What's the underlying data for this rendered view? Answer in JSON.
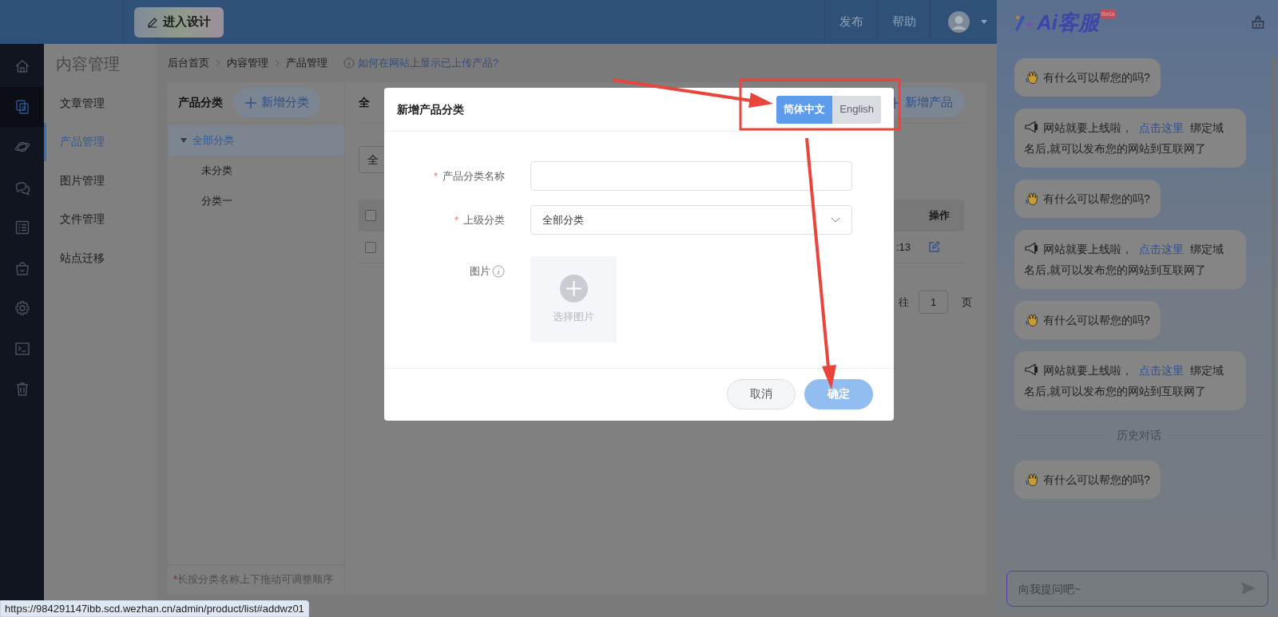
{
  "topbar": {
    "design_button": "进入设计",
    "nav": [
      "发布",
      "帮助"
    ]
  },
  "rail": [
    {
      "kind": "home",
      "selected": false
    },
    {
      "kind": "pages",
      "selected": true
    },
    {
      "kind": "planet",
      "selected": false
    },
    {
      "kind": "chat",
      "selected": false
    },
    {
      "kind": "list",
      "selected": false
    },
    {
      "kind": "bag",
      "selected": false
    },
    {
      "kind": "gear",
      "selected": false
    },
    {
      "kind": "terminal",
      "selected": false
    },
    {
      "kind": "trash",
      "selected": false
    }
  ],
  "sidebar": {
    "title": "内容管理",
    "items": [
      {
        "label": "文章管理",
        "selected": false
      },
      {
        "label": "产品管理",
        "selected": true
      },
      {
        "label": "图片管理",
        "selected": false
      },
      {
        "label": "文件管理",
        "selected": false
      },
      {
        "label": "站点迁移",
        "selected": false
      }
    ]
  },
  "breadcrumb": [
    "后台首页",
    "内容管理",
    "产品管理"
  ],
  "help_link": "如何在网站上显示已上传产品?",
  "category_panel": {
    "title": "产品分类",
    "add_button": "新增分类",
    "tree": [
      {
        "label": "全部分类",
        "selected": true,
        "expanded": true,
        "children": [
          {
            "label": "未分类",
            "selected": false
          },
          {
            "label": "分类一",
            "selected": false
          }
        ]
      }
    ],
    "footnote_mark": "*",
    "footnote": "长按分类名称上下拖动可调整顺序"
  },
  "product_panel": {
    "title": "全",
    "filter": "全",
    "add_button": "新增产品",
    "header_checked": false,
    "columns": [
      "操作"
    ],
    "rows": [
      {
        "checked": false,
        "cells": [
          ":13"
        ]
      }
    ],
    "pagination": {
      "goto": "往",
      "page": "1",
      "unit": "页"
    }
  },
  "dialog": {
    "title": "新增产品分类",
    "languages": [
      {
        "label": "简体中文",
        "selected": true
      },
      {
        "label": "English",
        "selected": false
      }
    ],
    "fields": [
      {
        "kind": "text",
        "mark": "*",
        "label": "产品分类名称"
      },
      {
        "kind": "select",
        "mark": "*",
        "label": "上级分类",
        "value": "全部分类"
      },
      {
        "kind": "image",
        "label": "图片",
        "hint": "选择图片"
      }
    ],
    "buttons": [
      {
        "kind": "secondary",
        "label": "取消"
      },
      {
        "kind": "primary",
        "label": "确定"
      }
    ]
  },
  "chat": {
    "title": "Ai客服",
    "badge": "Beta",
    "messages": [
      {
        "kind": "greeting",
        "text": "有什么可以帮您的吗?"
      },
      {
        "kind": "notice",
        "text": "网站就要上线啦，",
        "link": "点击这里",
        "text_after": "绑定域名后,就可以发布您的网站到互联网了"
      },
      {
        "kind": "greeting",
        "text": "有什么可以帮您的吗?"
      },
      {
        "kind": "notice",
        "text": "网站就要上线啦，",
        "link": "点击这里",
        "text_after": "绑定域名后,就可以发布您的网站到互联网了"
      },
      {
        "kind": "greeting",
        "text": "有什么可以帮您的吗?"
      },
      {
        "kind": "notice",
        "text": "网站就要上线啦，",
        "link": "点击这里",
        "text_after": "绑定域名后,就可以发布您的网站到互联网了"
      },
      {
        "kind": "divider",
        "text": "历史对话"
      },
      {
        "kind": "greeting",
        "text": "有什么可以帮您的吗?"
      }
    ],
    "input": {
      "placeholder": "向我提问吧~"
    }
  },
  "status_url": "https://984291147ibb.scd.wezhan.cn/admin/product/list#addwz01"
}
